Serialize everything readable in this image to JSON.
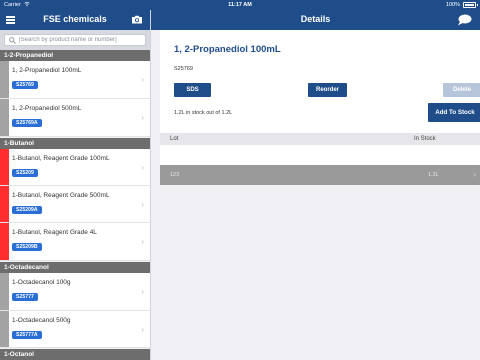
{
  "statusbar": {
    "carrier": "Carrier",
    "time": "11:17 AM",
    "battery": "100%"
  },
  "left_nav": {
    "title": "FSE chemicals"
  },
  "right_nav": {
    "title": "Details"
  },
  "search": {
    "placeholder": "[Search by product name or number]"
  },
  "colors": {
    "brand": "#1f4d8a",
    "badge": "#2b6fd6",
    "header_gray": "#6d6d6d",
    "alert_red": "#ff2d2d"
  },
  "icons": [
    "menu-icon",
    "camera-icon",
    "chat-icon",
    "search-icon",
    "wifi-icon",
    "battery-icon",
    "chevron-right-icon"
  ],
  "sections": [
    {
      "title": "1-2-Propanediol",
      "items": [
        {
          "name": "1, 2-Propanediol 100mL",
          "code": "S25769",
          "marker": "gray"
        },
        {
          "name": "1, 2-Propanediol 500mL",
          "code": "S25769A",
          "marker": "gray"
        }
      ]
    },
    {
      "title": "1-Butanol",
      "items": [
        {
          "name": "1-Butanol, Reagent Grade 100mL",
          "code": "S25209",
          "marker": "red"
        },
        {
          "name": "1-Butanol, Reagent Grade 500mL",
          "code": "S25209A",
          "marker": "red"
        },
        {
          "name": "1-Butanol, Reagent Grade 4L",
          "code": "S25209B",
          "marker": "red"
        }
      ]
    },
    {
      "title": "1-Octadecanol",
      "items": [
        {
          "name": "1-Octadecanol 100g",
          "code": "S25777",
          "marker": "gray"
        },
        {
          "name": "1-Octadecanol 500g",
          "code": "S25777A",
          "marker": "gray"
        }
      ]
    },
    {
      "title": "1-Octanol",
      "items": []
    }
  ],
  "detail": {
    "title": "1, 2-Propanediol 100mL",
    "code": "S25769",
    "sds_label": "SDS",
    "reorder_label": "Reorder",
    "delete_label": "Delete",
    "add_label": "Add To Stock",
    "stock_text": "1.2L in stock out of 1.2L",
    "table": {
      "headers": {
        "lot": "Lot",
        "in_stock": "In Stock"
      },
      "rows": [
        {
          "lot": "123",
          "in_stock": "1.2L"
        }
      ]
    }
  }
}
